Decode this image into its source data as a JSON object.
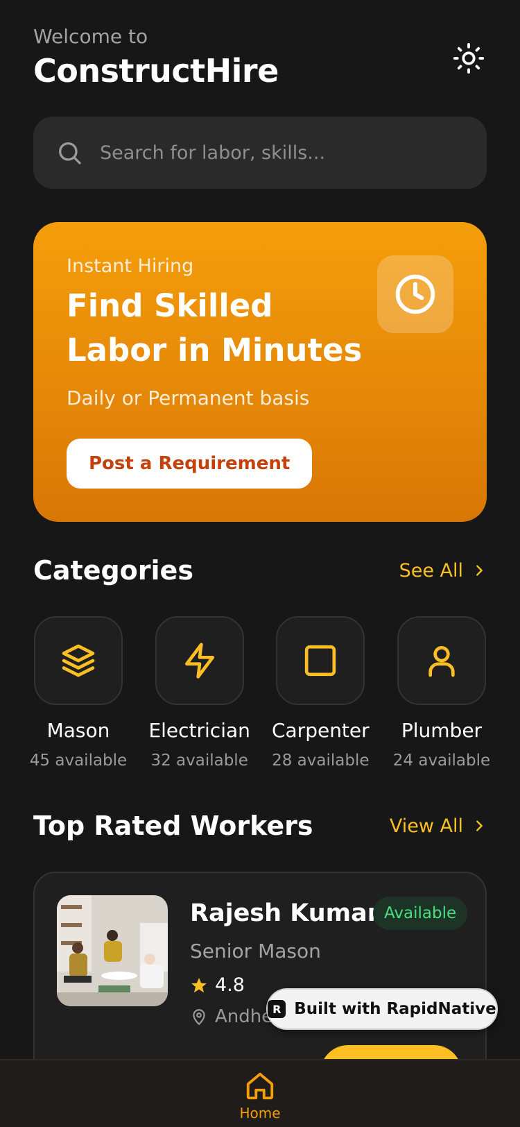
{
  "header": {
    "welcome": "Welcome to",
    "app_name": "ConstructHire"
  },
  "search": {
    "placeholder": "Search for labor, skills..."
  },
  "hero": {
    "eyebrow": "Instant Hiring",
    "title": "Find Skilled Labor in Minutes",
    "subtitle": "Daily or Permanent basis",
    "cta_label": "Post a Requirement"
  },
  "categories": {
    "title": "Categories",
    "see_all": "See All",
    "items": [
      {
        "name": "Mason",
        "available": "45 available",
        "icon": "layers-icon"
      },
      {
        "name": "Electrician",
        "available": "32 available",
        "icon": "lightning-icon"
      },
      {
        "name": "Carpenter",
        "available": "28 available",
        "icon": "square-icon"
      },
      {
        "name": "Plumber",
        "available": "24 available",
        "icon": "user-icon"
      }
    ]
  },
  "top_workers": {
    "title": "Top Rated Workers",
    "view_all": "View All",
    "workers": [
      {
        "name": "Rajesh Kumar",
        "role": "Senior Mason",
        "rating": "4.8",
        "location": "Andheri",
        "status": "Available"
      }
    ]
  },
  "badge": {
    "label": "Built with RapidNative"
  },
  "tabbar": {
    "home": "Home"
  },
  "colors": {
    "accent": "#fbbf24",
    "hero_top": "#f59e0b",
    "hero_bottom": "#d97706",
    "available_green": "#4ade80",
    "background": "#171717"
  }
}
